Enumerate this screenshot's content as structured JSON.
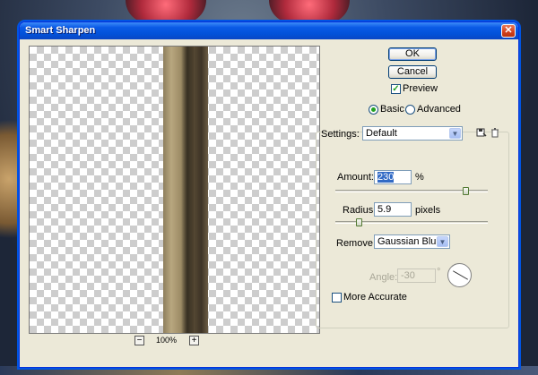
{
  "window": {
    "title": "Smart Sharpen",
    "close_glyph": "✕"
  },
  "preview": {
    "zoom_out": "−",
    "zoom_in": "+",
    "zoom_level": "100%"
  },
  "buttons": {
    "ok": "OK",
    "cancel": "Cancel"
  },
  "preview_toggle": {
    "label": "Preview",
    "checked": true
  },
  "mode": {
    "basic": "Basic",
    "advanced": "Advanced",
    "selected": "basic"
  },
  "settings": {
    "label": "Settings:",
    "value": "Default",
    "save_icon": "save-settings-icon",
    "delete_icon": "delete-settings-icon"
  },
  "amount": {
    "label": "Amount:",
    "value": "230",
    "unit": "%",
    "slider_fraction": 0.92
  },
  "radius": {
    "label": "Radius:",
    "value": "5.9",
    "unit": "pixels",
    "slider_fraction": 0.09
  },
  "remove": {
    "label": "Remove:",
    "value": "Gaussian Blur"
  },
  "angle": {
    "label": "Angle:",
    "value": "-30",
    "unit": "°"
  },
  "more_accurate": {
    "label": "More Accurate",
    "checked": false
  }
}
